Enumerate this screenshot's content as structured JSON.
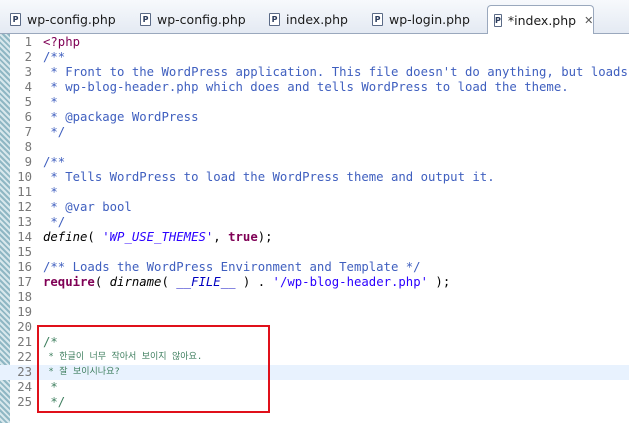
{
  "tabs": [
    {
      "label": "wp-config.php",
      "icon": "php-file-icon",
      "active": false
    },
    {
      "label": "wp-config.php",
      "icon": "php-file-icon",
      "active": false
    },
    {
      "label": "index.php",
      "icon": "php-file-icon",
      "active": false
    },
    {
      "label": "wp-login.php",
      "icon": "php-file-icon",
      "active": false
    },
    {
      "label": "*index.php",
      "icon": "php-file-icon",
      "active": true,
      "close": "✕"
    }
  ],
  "editor": {
    "line_numbers": [
      "1",
      "2",
      "3",
      "4",
      "5",
      "6",
      "7",
      "8",
      "9",
      "10",
      "11",
      "12",
      "13",
      "14",
      "15",
      "16",
      "17",
      "18",
      "19",
      "20",
      "21",
      "22",
      "23",
      "24",
      "25"
    ],
    "lines": {
      "l1": "<?php",
      "l2": "/**",
      "l3": " * Front to the WordPress application. This file doesn't do anything, but loads",
      "l4": " * wp-blog-header.php which does and tells WordPress to load the theme.",
      "l5": " *",
      "l6": " * @package WordPress",
      "l7": " */",
      "l8": "",
      "l9": "/**",
      "l10": " * Tells WordPress to load the WordPress theme and output it.",
      "l11": " *",
      "l12": " * @var bool",
      "l13": " */",
      "l14_fn": "define",
      "l14_a": "( ",
      "l14_str": "'WP_USE_THEMES'",
      "l14_b": ", ",
      "l14_kw": "true",
      "l14_c": ");",
      "l15": "",
      "l16": "/** Loads the WordPress Environment and Template */",
      "l17_kw": "require",
      "l17_a": "( ",
      "l17_fn": "dirname",
      "l17_b": "( ",
      "l17_const": "__FILE__",
      "l17_c": " ) . ",
      "l17_str": "'/wp-blog-header.php'",
      "l17_d": " );",
      "l18": "",
      "l19": "",
      "l20": "",
      "l21": "/*",
      "l22": " * 한글이 너무 작아서 보이지 않아요.",
      "l23": " * 잘 보이시나요?",
      "l24": " *",
      "l25": " */"
    },
    "current_line": 23
  },
  "colors": {
    "keyword": "#7f0055",
    "comment_doc": "#3f5fbf",
    "comment": "#3f7f5f",
    "string": "#2a00ff",
    "current_line_bg": "#e8f2fe",
    "annotation_box": "#e0101a"
  }
}
